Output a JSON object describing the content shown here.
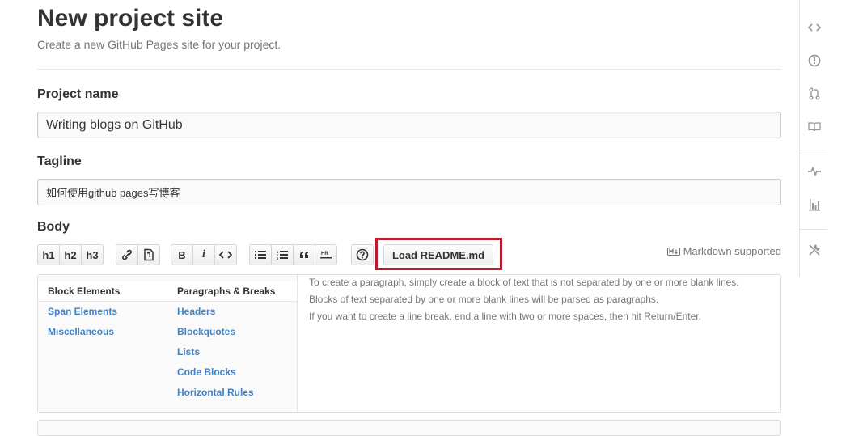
{
  "header": {
    "title": "New project site",
    "subtitle": "Create a new GitHub Pages site for your project."
  },
  "form": {
    "project_name_label": "Project name",
    "project_name_value": "Writing blogs on GitHub",
    "tagline_label": "Tagline",
    "tagline_value": "如何使用github pages写博客",
    "body_label": "Body"
  },
  "toolbar": {
    "h1": "h1",
    "h2": "h2",
    "h3": "h3",
    "bold": "B",
    "italic": "i",
    "load_readme": "Load README.md",
    "markdown_supported": "Markdown supported"
  },
  "help": {
    "column1": [
      "Block Elements",
      "Span Elements",
      "Miscellaneous"
    ],
    "column2": [
      "Paragraphs & Breaks",
      "Headers",
      "Blockquotes",
      "Lists",
      "Code Blocks",
      "Horizontal Rules"
    ],
    "paragraphs": [
      "To create a paragraph, simply create a block of text that is not separated by one or more blank lines.",
      "Blocks of text separated by one or more blank lines will be parsed as paragraphs.",
      "If you want to create a line break, end a line with two or more spaces, then hit Return/Enter."
    ]
  },
  "sidebar": {
    "icons": [
      "code-icon",
      "issues-icon",
      "pull-request-icon",
      "wiki-icon",
      "pulse-icon",
      "graphs-icon",
      "settings-icon"
    ]
  },
  "colors": {
    "link": "#4183c4",
    "highlight": "#b81c2e",
    "muted": "#767676"
  }
}
